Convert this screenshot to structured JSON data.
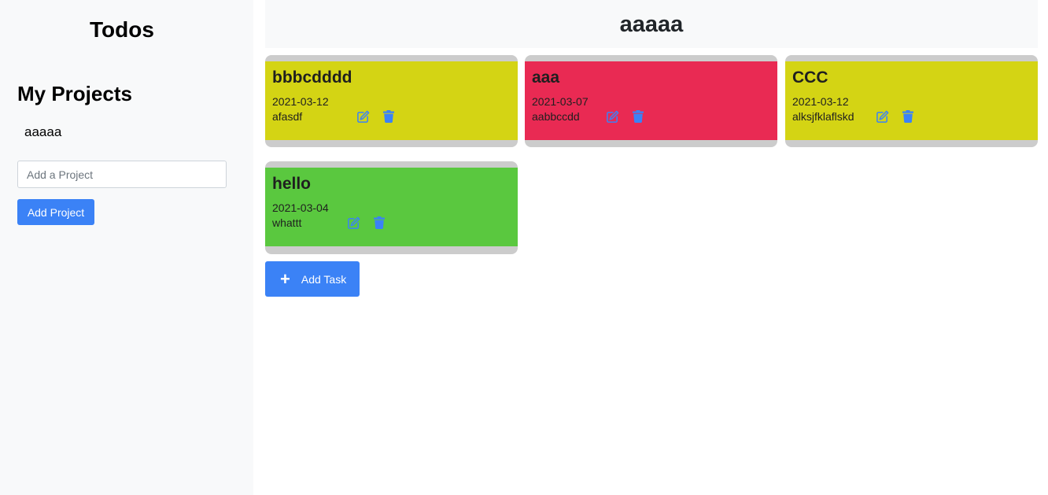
{
  "sidebar": {
    "app_title": "Todos",
    "projects_heading": "My Projects",
    "projects": [
      "aaaaa"
    ],
    "new_project_placeholder": "Add a Project",
    "add_project_label": "Add Project"
  },
  "main": {
    "project_title": "aaaaa",
    "add_task_label": "Add Task",
    "add_task_icon": "plus-icon",
    "tasks": [
      {
        "title": "bbbcdddd",
        "date": "2021-03-12",
        "description": "afasdf",
        "color": "#d4d414"
      },
      {
        "title": "aaa",
        "date": "2021-03-07",
        "description": "aabbccdd",
        "color": "#e92a53"
      },
      {
        "title": "CCC",
        "date": "2021-03-12",
        "description": "alksjfklaflskd",
        "color": "#d4d414"
      },
      {
        "title": "hello",
        "date": "2021-03-04",
        "description": "whattt",
        "color": "#5ac83f"
      }
    ]
  },
  "icons": {
    "edit": "edit-icon",
    "delete": "trash-icon",
    "accent": "#3b82f6"
  }
}
